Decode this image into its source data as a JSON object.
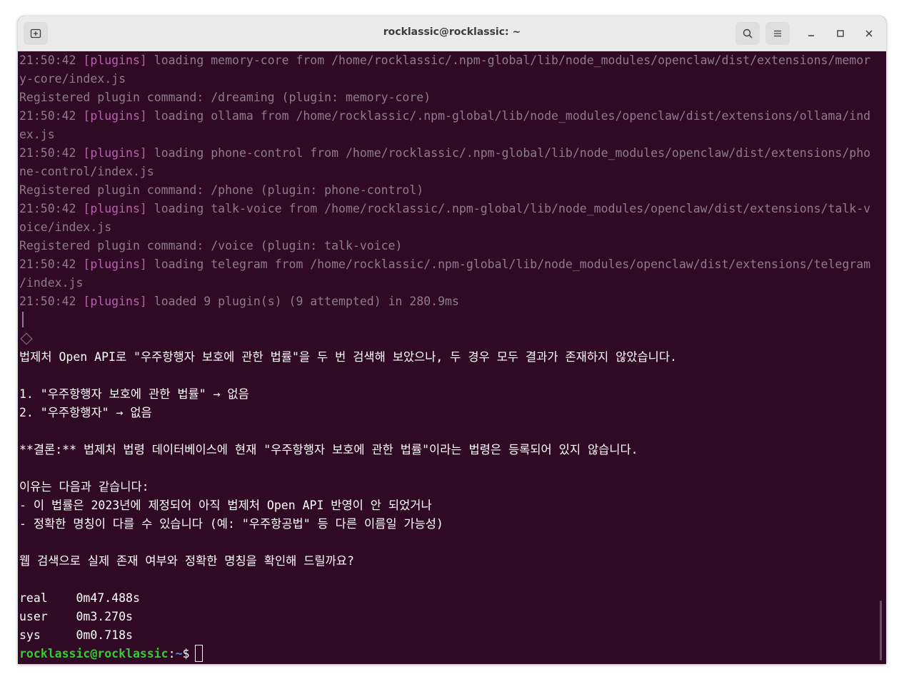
{
  "window": {
    "title": "rocklassic@rocklassic: ~"
  },
  "titlebar": {
    "new_tab_icon": "new-tab-icon",
    "search_icon": "search-icon",
    "menu_icon": "hamburger-menu-icon",
    "minimize_icon": "minimize-icon",
    "maximize_icon": "maximize-icon",
    "close_icon": "close-icon"
  },
  "log": [
    {
      "time": "21:50:42",
      "tag": "[plugins]",
      "msg": " loading memory-core from /home/rocklassic/.npm-global/lib/node_modules/openclaw/dist/extensions/memor"
    },
    {
      "cont": "y-core/index.js"
    },
    {
      "plain": "Registered plugin command: /dreaming (plugin: memory-core)"
    },
    {
      "time": "21:50:42",
      "tag": "[plugins]",
      "msg": " loading ollama from /home/rocklassic/.npm-global/lib/node_modules/openclaw/dist/extensions/ollama/ind"
    },
    {
      "cont": "ex.js"
    },
    {
      "time": "21:50:42",
      "tag": "[plugins]",
      "msg": " loading phone-control from /home/rocklassic/.npm-global/lib/node_modules/openclaw/dist/extensions/pho"
    },
    {
      "cont": "ne-control/index.js"
    },
    {
      "plain": "Registered plugin command: /phone (plugin: phone-control)"
    },
    {
      "time": "21:50:42",
      "tag": "[plugins]",
      "msg": " loading talk-voice from /home/rocklassic/.npm-global/lib/node_modules/openclaw/dist/extensions/talk-v"
    },
    {
      "cont": "oice/index.js"
    },
    {
      "plain": "Registered plugin command: /voice (plugin: talk-voice)"
    },
    {
      "time": "21:50:42",
      "tag": "[plugins]",
      "msg": " loading telegram from /home/rocklassic/.npm-global/lib/node_modules/openclaw/dist/extensions/telegram"
    },
    {
      "cont": "/index.js"
    },
    {
      "time": "21:50:42",
      "tag": "[plugins]",
      "msg": " loaded 9 plugin(s) (9 attempted) in 280.9ms"
    }
  ],
  "response": [
    "법제처 Open API로 \"우주항행자 보호에 관한 법률\"을 두 번 검색해 보았으나, 두 경우 모두 결과가 존재하지 않았습니다.",
    "",
    "1. \"우주항행자 보호에 관한 법률\" → 없음",
    "2. \"우주항행자\" → 없음",
    "",
    "**결론:** 법제처 법령 데이터베이스에 현재 \"우주항행자 보호에 관한 법률\"이라는 법령은 등록되어 있지 않습니다.",
    "",
    "이유는 다음과 같습니다:",
    "- 이 법률은 2023년에 제정되어 아직 법제처 Open API 반영이 안 되었거나",
    "- 정확한 명칭이 다를 수 있습니다 (예: \"우주항공법\" 등 다른 이름일 가능성)",
    "",
    "웹 검색으로 실제 존재 여부와 정확한 명칭을 확인해 드릴까요?",
    ""
  ],
  "timing": {
    "real_label": "real",
    "real_value": "0m47.488s",
    "user_label": "user",
    "user_value": "0m3.270s",
    "sys_label": "sys",
    "sys_value": "0m0.718s"
  },
  "prompt": {
    "user_host": "rocklassic@rocklassic",
    "colon": ":",
    "path": "~",
    "symbol": "$"
  },
  "colors": {
    "background": "#300a24",
    "prompt_user": "#33cc33",
    "prompt_path": "#5f87d7",
    "log_tag": "#b960b0",
    "log_dim": "#8f7b8a"
  }
}
